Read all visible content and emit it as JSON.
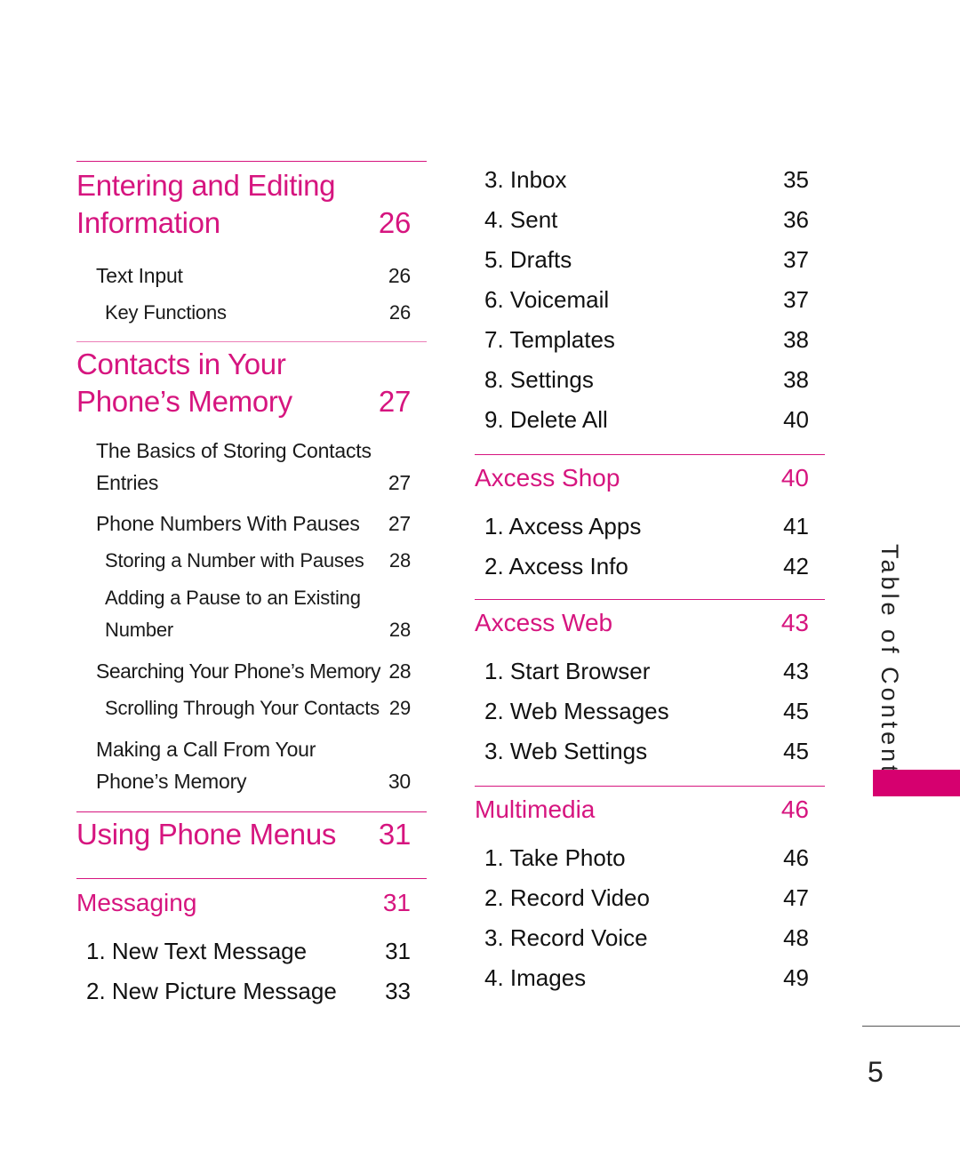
{
  "left": {
    "sections": [
      {
        "chapter": {
          "title": "Entering and Editing Information",
          "page": "26"
        },
        "entries": [
          {
            "title": "Text Input",
            "page": "26",
            "level": 1
          },
          {
            "title": "Key Functions",
            "page": "26",
            "level": 2
          }
        ]
      },
      {
        "chapter": {
          "title": "Contacts in Your Phone’s Memory",
          "page": "27"
        },
        "entries": [
          {
            "title": "The Basics of Storing Contacts Entries",
            "page": "27",
            "level": 1
          },
          {
            "title": "Phone Numbers With Pauses",
            "page": "27",
            "level": 1
          },
          {
            "title": "Storing a Number with Pauses",
            "page": "28",
            "level": 2
          },
          {
            "title": "Adding a Pause to an Existing Number",
            "page": "28",
            "level": 2
          },
          {
            "title": "Searching Your Phone’s Memory",
            "page": "28",
            "level": 1
          },
          {
            "title": "Scrolling Through Your Contacts",
            "page": "29",
            "level": 2
          },
          {
            "title": "Making a Call From Your Phone’s Memory",
            "page": "30",
            "level": 1
          }
        ]
      },
      {
        "chapter": {
          "title": "Using Phone Menus",
          "page": "31"
        },
        "entries": []
      }
    ],
    "messaging": {
      "title": "Messaging",
      "page": "31",
      "items": [
        {
          "label": "1. New Text Message",
          "page": "31"
        },
        {
          "label": "2. New Picture Message",
          "page": "33"
        }
      ]
    }
  },
  "right": {
    "messaging_cont": [
      {
        "label": "3. Inbox",
        "page": "35"
      },
      {
        "label": "4. Sent",
        "page": "36"
      },
      {
        "label": "5. Drafts",
        "page": "37"
      },
      {
        "label": "6. Voicemail",
        "page": "37"
      },
      {
        "label": "7. Templates",
        "page": "38"
      },
      {
        "label": "8. Settings",
        "page": "38"
      },
      {
        "label": "9. Delete All",
        "page": "40"
      }
    ],
    "menus": [
      {
        "title": "Axcess Shop",
        "page": "40",
        "items": [
          {
            "label": "1. Axcess Apps",
            "page": "41"
          },
          {
            "label": "2. Axcess Info",
            "page": "42"
          }
        ]
      },
      {
        "title": "Axcess Web",
        "page": "43",
        "items": [
          {
            "label": "1. Start Browser",
            "page": "43"
          },
          {
            "label": "2. Web Messages",
            "page": "45"
          },
          {
            "label": "3. Web Settings",
            "page": "45"
          }
        ]
      },
      {
        "title": "Multimedia",
        "page": "46",
        "items": [
          {
            "label": "1. Take Photo",
            "page": "46"
          },
          {
            "label": "2. Record Video",
            "page": "47"
          },
          {
            "label": "3. Record Voice",
            "page": "48"
          },
          {
            "label": "4. Images",
            "page": "49"
          }
        ]
      }
    ]
  },
  "side_label": "Table of Contents",
  "accent_color": "#d6157f",
  "page_number": "5"
}
